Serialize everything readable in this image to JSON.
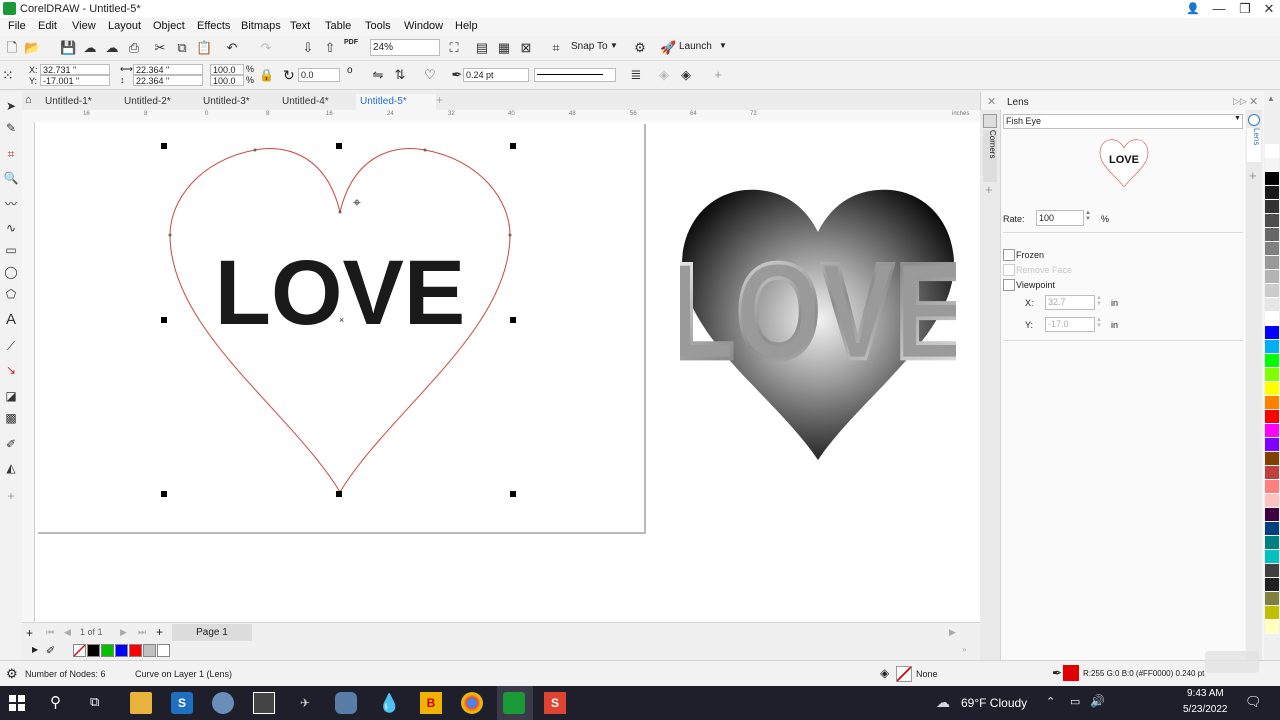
{
  "app": {
    "title": "CorelDRAW - Untitled-5*"
  },
  "menu": [
    "File",
    "Edit",
    "View",
    "Layout",
    "Object",
    "Effects",
    "Bitmaps",
    "Text",
    "Table",
    "Tools",
    "Window",
    "Help"
  ],
  "standard_toolbar": {
    "zoom": "24%",
    "snap_label": "Snap To",
    "launch_label": "Launch",
    "pdf_label": "PDF"
  },
  "property_bar": {
    "x": "32.731 \"",
    "y": "-17.001 \"",
    "w": "22.364 \"",
    "h": "22.364 \"",
    "scale_w": "100.0",
    "scale_h": "100.0",
    "pct": "%",
    "rotation": "0.0",
    "deg": "o",
    "outline": "0.24 pt"
  },
  "tabs": [
    "Untitled-1*",
    "Untitled-2*",
    "Untitled-3*",
    "Untitled-4*",
    "Untitled-5*"
  ],
  "ruler": {
    "labels": [
      "16",
      "8",
      "0",
      "8",
      "16",
      "24",
      "32",
      "40",
      "48",
      "56",
      "64",
      "72"
    ],
    "unit": "inches"
  },
  "canvas": {
    "heart_text": "LOVE",
    "lens_text": "LOVE"
  },
  "pagenav": {
    "pages": "1  of  1",
    "page_tab": "Page 1"
  },
  "docker": {
    "title": "Lens",
    "lens_type": "Fish Eye",
    "preview_text": "LOVE",
    "rate_label": "Rate:",
    "rate_value": "100",
    "rate_unit": "%",
    "frozen_label": "Frozen",
    "remove_face_label": "Remove Face",
    "viewpoint_label": "Viewpoint",
    "x_label": "X:",
    "x_value": "32.7",
    "x_unit": "in",
    "y_label": "Y:",
    "y_value": "-17.0",
    "y_unit": "in",
    "side_tabs": [
      "Corners",
      "Lens"
    ]
  },
  "status": {
    "nodes": "Number of Nodes: 6",
    "layer": "Curve on Layer 1  (Lens)",
    "fill_label": "None",
    "outline_info": "R:255 G:0 B:0 (#FF0000)  0.240 pt"
  },
  "taskbar": {
    "weather": "69°F  Cloudy",
    "time": "9:43 AM",
    "date": "5/23/2022"
  },
  "colors": {
    "accent": "#1f6fd0",
    "outline_red": "#d0463f",
    "app_green": "#1a9a36"
  },
  "palette_colors": [
    "#ffffff",
    "#000000",
    "#00c000",
    "#0000ff",
    "#ff0000",
    "#c0c0c0",
    "#ffffff"
  ],
  "side_palette": [
    "#ffffff",
    "#f4f4f4",
    "#000000",
    "#1a1a1a",
    "#333333",
    "#4d4d4d",
    "#666666",
    "#808080",
    "#999999",
    "#b3b3b3",
    "#cccccc",
    "#e6e6e6",
    "#ffffff",
    "#0000ff",
    "#00b0f0",
    "#00ff00",
    "#80ff00",
    "#ffff00",
    "#ff8000",
    "#ff0000",
    "#ff00ff",
    "#8000ff",
    "#804000",
    "#c04040",
    "#ff8080",
    "#ffc0c0",
    "#400040",
    "#004080",
    "#008080",
    "#00c0c0",
    "#404040",
    "#202020",
    "#808040",
    "#c0c000",
    "#ffffc0"
  ]
}
